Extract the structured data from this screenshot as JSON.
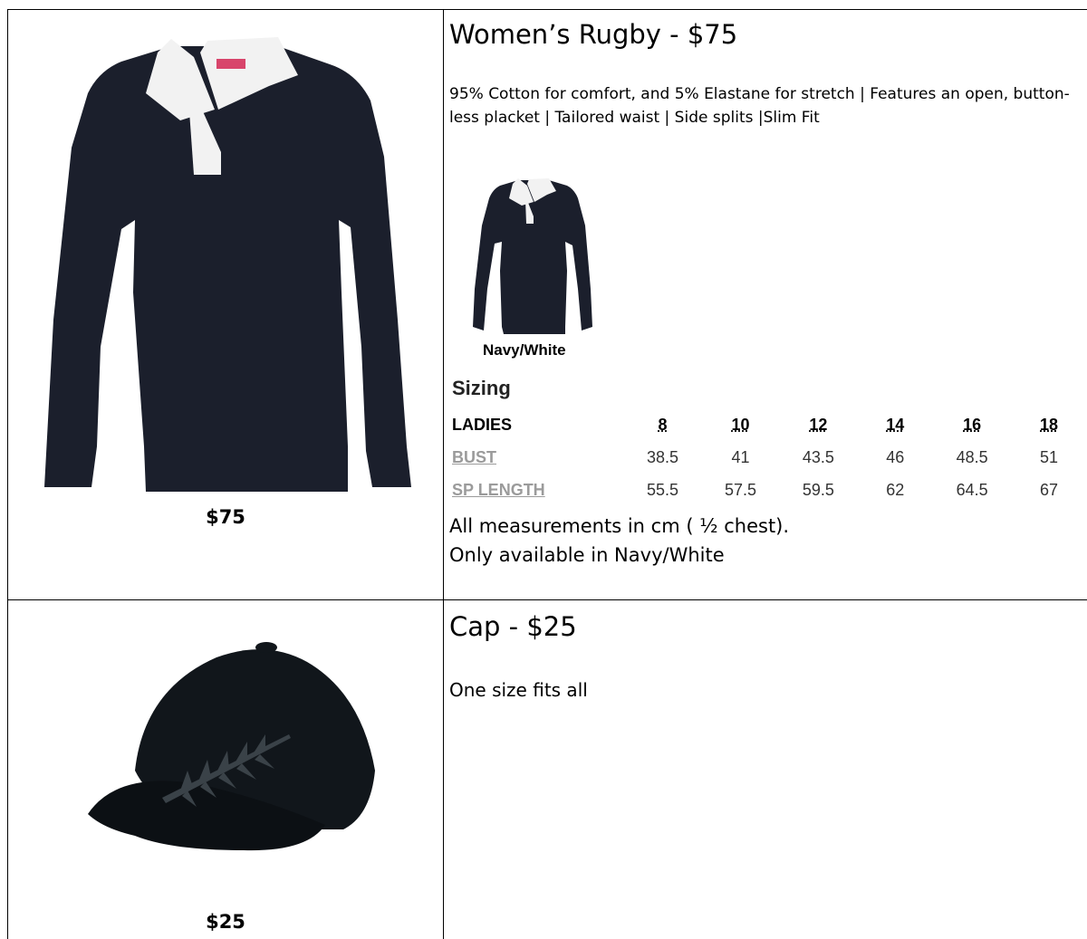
{
  "products": [
    {
      "price_caption": "$75",
      "title": "Women’s Rugby - $75",
      "description": "95% Cotton for comfort, and 5% Elastane for stretch | Features an open, button-less placket | Tailored waist | Side splits |Slim Fit",
      "colour_label": "Navy/White",
      "colors": {
        "navy": "#1b1f2c",
        "collar": "#f2f2f2",
        "tag": "#d8456b"
      },
      "sizing": {
        "title": "Sizing",
        "header_label": "LADIES",
        "sizes": [
          "8",
          "10",
          "12",
          "14",
          "16",
          "18"
        ],
        "rows": [
          {
            "label": "BUST",
            "values": [
              "38.5",
              "41",
              "43.5",
              "46",
              "48.5",
              "51"
            ]
          },
          {
            "label": "SP LENGTH",
            "values": [
              "55.5",
              "57.5",
              "59.5",
              "62",
              "64.5",
              "67"
            ]
          }
        ]
      },
      "notes": [
        "All measurements in cm ( ½ chest).",
        "Only available in Navy/White"
      ]
    },
    {
      "price_caption": "$25",
      "title": "Cap - $25",
      "description": "One size fits all",
      "colors": {
        "cap": "#11161b",
        "fern": "#3a4248"
      }
    }
  ]
}
